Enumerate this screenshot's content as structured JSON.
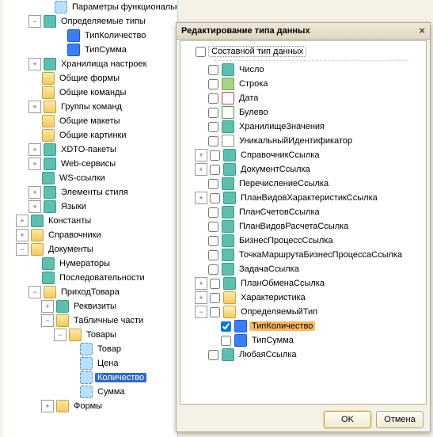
{
  "dialog": {
    "title": "Редактирование типа данных",
    "composite_label": "Составной тип данных",
    "ok": "OK",
    "cancel": "Отмена"
  },
  "tree_left": [
    {
      "exp": "",
      "ind": 2,
      "ico": "prop",
      "text": "Параметры функциональных опций"
    },
    {
      "exp": "-",
      "ind": 1,
      "ico": "teal",
      "text": "Определяемые типы"
    },
    {
      "exp": "",
      "ind": 3,
      "ico": "blue-sq",
      "text": "ТипКоличество"
    },
    {
      "exp": "",
      "ind": 3,
      "ico": "blue-sq",
      "text": "ТипСумма"
    },
    {
      "exp": "+",
      "ind": 1,
      "ico": "teal",
      "text": "Хранилища настроек"
    },
    {
      "exp": "",
      "ind": 1,
      "ico": "folder",
      "text": "Общие формы"
    },
    {
      "exp": "",
      "ind": 1,
      "ico": "folder",
      "text": "Общие команды"
    },
    {
      "exp": "+",
      "ind": 1,
      "ico": "folder",
      "text": "Группы команд"
    },
    {
      "exp": "",
      "ind": 1,
      "ico": "folder",
      "text": "Общие макеты"
    },
    {
      "exp": "",
      "ind": 1,
      "ico": "folder",
      "text": "Общие картинки"
    },
    {
      "exp": "+",
      "ind": 1,
      "ico": "teal",
      "text": "XDTO-пакеты"
    },
    {
      "exp": "+",
      "ind": 1,
      "ico": "teal",
      "text": "Web-сервисы"
    },
    {
      "exp": "",
      "ind": 1,
      "ico": "teal",
      "text": "WS-ссылки"
    },
    {
      "exp": "+",
      "ind": 1,
      "ico": "teal",
      "text": "Элементы стиля"
    },
    {
      "exp": "+",
      "ind": 1,
      "ico": "teal",
      "text": "Языки"
    },
    {
      "exp": "+",
      "ind": 0,
      "ico": "teal",
      "text": "Константы"
    },
    {
      "exp": "+",
      "ind": 0,
      "ico": "folder",
      "text": "Справочники"
    },
    {
      "exp": "-",
      "ind": 0,
      "ico": "folder",
      "text": "Документы"
    },
    {
      "exp": "",
      "ind": 1,
      "ico": "teal",
      "text": "Нумераторы"
    },
    {
      "exp": "",
      "ind": 1,
      "ico": "teal",
      "text": "Последовательности"
    },
    {
      "exp": "-",
      "ind": 1,
      "ico": "folder",
      "text": "ПриходТовара"
    },
    {
      "exp": "+",
      "ind": 2,
      "ico": "teal",
      "text": "Реквизиты"
    },
    {
      "exp": "-",
      "ind": 2,
      "ico": "folder",
      "text": "Табличные части"
    },
    {
      "exp": "-",
      "ind": 3,
      "ico": "folder",
      "text": "Товары"
    },
    {
      "exp": "",
      "ind": 4,
      "ico": "prop",
      "text": "Товар"
    },
    {
      "exp": "",
      "ind": 4,
      "ico": "prop",
      "text": "Цена"
    },
    {
      "exp": "",
      "ind": 4,
      "ico": "prop",
      "text": "Количество",
      "sel": "sel2"
    },
    {
      "exp": "",
      "ind": 4,
      "ico": "prop",
      "text": "Сумма"
    },
    {
      "exp": "+",
      "ind": 2,
      "ico": "folder",
      "text": "Формы"
    }
  ],
  "tree_right": [
    {
      "exp": "b",
      "ind": 0,
      "chk": false,
      "ico": "teal",
      "text": "Число"
    },
    {
      "exp": "b",
      "ind": 0,
      "chk": false,
      "ico": "green",
      "text": "Строка"
    },
    {
      "exp": "b",
      "ind": 0,
      "chk": false,
      "ico": "cal",
      "text": "Дата"
    },
    {
      "exp": "b",
      "ind": 0,
      "chk": false,
      "ico": "check",
      "text": "Булево"
    },
    {
      "exp": "b",
      "ind": 0,
      "chk": false,
      "ico": "teal",
      "text": "ХранилищеЗначения"
    },
    {
      "exp": "b",
      "ind": 0,
      "chk": false,
      "ico": "id",
      "text": "УникальныйИдентификатор"
    },
    {
      "exp": "+",
      "ind": 0,
      "chk": false,
      "ico": "teal",
      "text": "СправочникСсылка"
    },
    {
      "exp": "+",
      "ind": 0,
      "chk": false,
      "ico": "teal",
      "text": "ДокументСсылка"
    },
    {
      "exp": "b",
      "ind": 0,
      "chk": false,
      "ico": "teal",
      "text": "ПеречислениеСсылка"
    },
    {
      "exp": "+",
      "ind": 0,
      "chk": false,
      "ico": "teal",
      "text": "ПланВидовХарактеристикСсылка"
    },
    {
      "exp": "b",
      "ind": 0,
      "chk": false,
      "ico": "teal",
      "text": "ПланСчетовСсылка"
    },
    {
      "exp": "b",
      "ind": 0,
      "chk": false,
      "ico": "teal",
      "text": "ПланВидовРасчетаСсылка"
    },
    {
      "exp": "b",
      "ind": 0,
      "chk": false,
      "ico": "teal",
      "text": "БизнесПроцессСсылка"
    },
    {
      "exp": "b",
      "ind": 0,
      "chk": false,
      "ico": "teal",
      "text": "ТочкаМаршрутаБизнесПроцессаСсылка"
    },
    {
      "exp": "b",
      "ind": 0,
      "chk": false,
      "ico": "teal",
      "text": "ЗадачаСсылка"
    },
    {
      "exp": "+",
      "ind": 0,
      "chk": false,
      "ico": "teal",
      "text": "ПланОбменаСсылка"
    },
    {
      "exp": "+",
      "ind": 0,
      "chk": false,
      "ico": "folder",
      "text": "Характеристика"
    },
    {
      "exp": "-",
      "ind": 0,
      "chk": false,
      "ico": "folder-open",
      "text": "ОпределяемыйТип"
    },
    {
      "exp": "b",
      "ind": 1,
      "chk": true,
      "ico": "blue-sq",
      "text": "ТипКоличество",
      "sel": "sel"
    },
    {
      "exp": "b",
      "ind": 1,
      "chk": false,
      "ico": "blue-sq",
      "text": "ТипСумма"
    },
    {
      "exp": "b",
      "ind": 0,
      "chk": false,
      "ico": "teal",
      "text": "ЛюбаяСсылка"
    }
  ]
}
